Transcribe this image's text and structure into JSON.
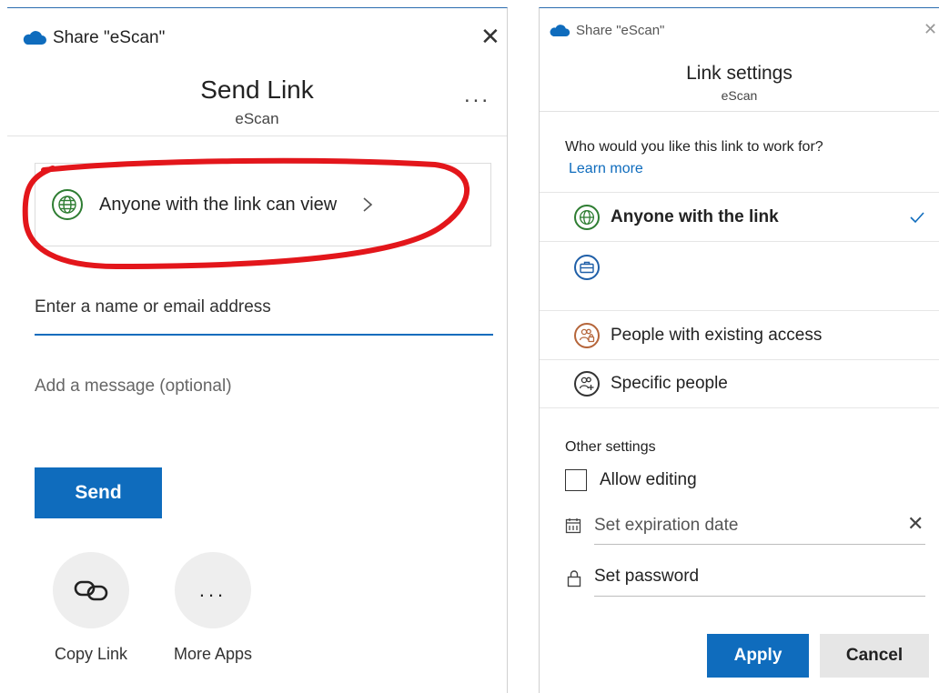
{
  "left": {
    "window_title": "Share \"eScan\"",
    "header_title": "Send Link",
    "header_subtitle": "eScan",
    "more_glyph": "...",
    "link_permission": "Anyone with the link can view",
    "recipient_placeholder": "Enter a name or email address",
    "message_placeholder": "Add a message (optional)",
    "send_label": "Send",
    "copy_link_label": "Copy Link",
    "more_apps_label": "More Apps"
  },
  "right": {
    "window_title": "Share \"eScan\"",
    "header_title": "Link settings",
    "header_subtitle": "eScan",
    "question": "Who would you like this link to work for?",
    "learn_more": "Learn more",
    "options": [
      {
        "label": "Anyone with the link",
        "selected": true
      },
      {
        "label": "",
        "selected": false
      },
      {
        "label": "People with existing access",
        "selected": false
      },
      {
        "label": "Specific people",
        "selected": false
      }
    ],
    "other_settings": "Other settings",
    "allow_editing": "Allow editing",
    "expiration_placeholder": "Set expiration date",
    "password_placeholder": "Set password",
    "apply_label": "Apply",
    "cancel_label": "Cancel"
  },
  "colors": {
    "accent": "#0f6cbd",
    "globe_green": "#2e7d32",
    "briefcase_blue": "#1f5fa8",
    "people_orange": "#b5653a",
    "annotation_red": "#e3161b"
  },
  "icons": [
    "cloud-icon",
    "close-icon",
    "more-icon",
    "globe-icon",
    "chevron-right-icon",
    "link-icon",
    "ellipsis-icon",
    "check-icon",
    "briefcase-icon",
    "people-lock-icon",
    "people-add-icon",
    "calendar-icon",
    "lock-icon"
  ]
}
